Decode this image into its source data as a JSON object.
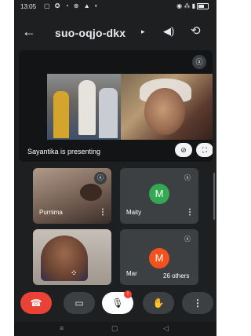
{
  "status_bar": {
    "time": "13:05",
    "left_glyphs": "▢ ✪ ◔ ⊕ ▲ •",
    "right_glyphs": "◉ ⁂ ▮"
  },
  "header": {
    "back": "←",
    "meeting_code": "suo-oqjo-dkx",
    "chevron": "▸",
    "speaker": "◀)",
    "switch_camera": "⟲"
  },
  "presentation": {
    "label": "Sayantika is presenting",
    "mute_glyph": "ⓧ",
    "pin_glyph": "⊘",
    "fullscreen_glyph": "⛶"
  },
  "participants": [
    {
      "name": "Purnima",
      "avatar_letter": "",
      "more": "⋮"
    },
    {
      "name": "Maity",
      "avatar_letter": "M",
      "more": "⋮"
    },
    {
      "name": "",
      "avatar_letter": "",
      "more": "⁘"
    },
    {
      "name": "Mar",
      "avatar_letter": "M",
      "more": ""
    }
  ],
  "others_label": "26 others",
  "controls": {
    "end": "☎",
    "camera": "▭",
    "mic": "🎙",
    "mic_badge": "!",
    "hand": "✋",
    "more": "⋮"
  },
  "nav": {
    "recents": "≡",
    "home": "▢",
    "back": "◁"
  },
  "colors": {
    "background": "#1e1f21",
    "end_call": "#ea4335",
    "avatar_green": "#34a853",
    "avatar_orange": "#f4511e",
    "tile": "#3c4043"
  }
}
